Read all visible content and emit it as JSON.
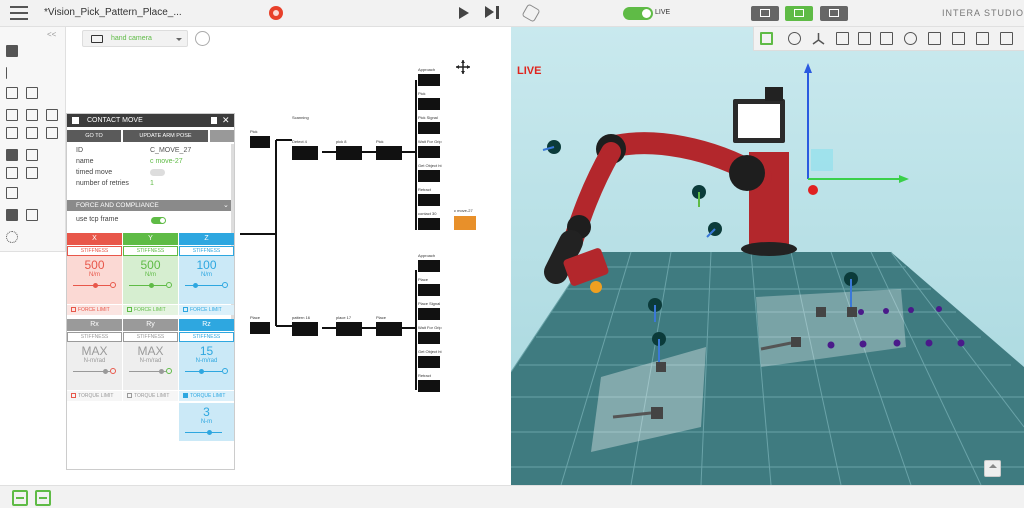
{
  "app": {
    "document_title": "*Vision_Pick_Pattern_Place_...",
    "brand": "INTERA STUDIO",
    "live_label": "LIVE"
  },
  "left_toolbar": {
    "collapse_label": "<<"
  },
  "camera": {
    "selected": "hand camera"
  },
  "contact_move_panel": {
    "title": "CONTACT MOVE",
    "go_to_label": "GO TO",
    "update_pose_label": "UPDATE ARM POSE",
    "properties": [
      {
        "key": "ID",
        "value": "C_MOVE_27"
      },
      {
        "key": "name",
        "value": "c move-27"
      },
      {
        "key": "timed move",
        "value": ""
      },
      {
        "key": "number of retries",
        "value": "1"
      }
    ],
    "section_title": "FORCE AND COMPLIANCE",
    "tcp_label": "use tcp frame",
    "linear_axes": [
      {
        "name": "X",
        "mode": "STIFFNESS",
        "value": "500",
        "unit": "N/m",
        "limit_label": "FORCE LIMIT",
        "color": "#e8574a"
      },
      {
        "name": "Y",
        "mode": "STIFFNESS",
        "value": "500",
        "unit": "N/m",
        "limit_label": "FORCE LIMIT",
        "color": "#5fbb46"
      },
      {
        "name": "Z",
        "mode": "STIFFNESS",
        "value": "100",
        "unit": "N/m",
        "limit_label": "FORCE LIMIT",
        "color": "#2ea7e0"
      }
    ],
    "rot_axes": [
      {
        "name": "Rx",
        "mode": "STIFFNESS",
        "value": "MAX",
        "unit": "N-m/rad",
        "limit_label": "TORQUE LIMIT"
      },
      {
        "name": "Ry",
        "mode": "STIFFNESS",
        "value": "MAX",
        "unit": "N-m/rad",
        "limit_label": "TORQUE LIMIT"
      },
      {
        "name": "Rz",
        "mode": "STIFFNESS",
        "value": "15",
        "unit": "N-m/rad",
        "limit_label": "TORQUE LIMIT"
      }
    ],
    "torque_limit": {
      "value": "3",
      "unit": "N-m"
    }
  },
  "behavior_tree": {
    "top_labels": [
      "Pick",
      "Scanning",
      "Detect 4",
      "pick 8",
      "Pick",
      "Approach",
      "Pick",
      "Pick Signal",
      "Wait For Grip",
      "Get Object ht",
      "Retract",
      "contact 30",
      "c move-27"
    ],
    "bottom_labels": [
      "Place",
      "pattern 16",
      "place 17",
      "Place",
      "Approach",
      "Place",
      "Place Signal",
      "Wait For Grip",
      "Get Object ht",
      "Retract"
    ]
  },
  "viewport": {
    "live_indicator": "LIVE"
  },
  "colors": {
    "accent": "#5fbb46",
    "robot": "#b3272c",
    "record": "#e8402a",
    "live_text": "#e0241d"
  }
}
